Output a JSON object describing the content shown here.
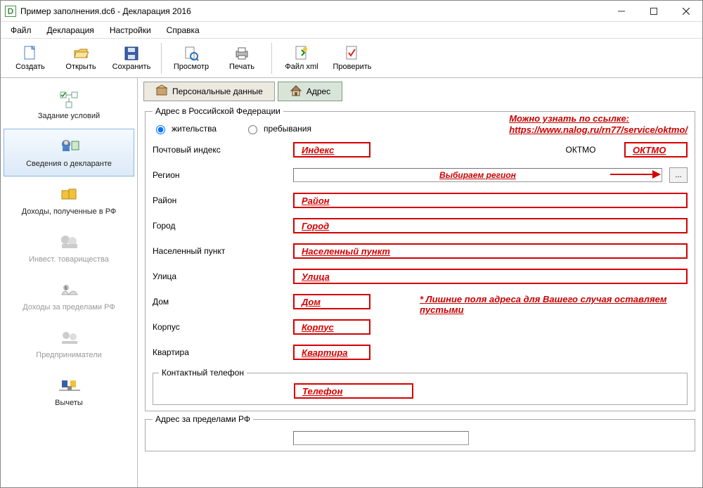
{
  "titlebar": {
    "app_letter": "D",
    "title": "Пример заполнения.dc6 - Декларация 2016"
  },
  "menubar": {
    "items": [
      "Файл",
      "Декларация",
      "Настройки",
      "Справка"
    ]
  },
  "toolbar": {
    "items": [
      {
        "label": "Создать"
      },
      {
        "label": "Открыть"
      },
      {
        "label": "Сохранить"
      },
      {
        "sep": true
      },
      {
        "label": "Просмотр"
      },
      {
        "label": "Печать"
      },
      {
        "sep": true
      },
      {
        "label": "Файл xml"
      },
      {
        "label": "Проверить"
      }
    ]
  },
  "sidebar": {
    "items": [
      {
        "label": "Задание условий",
        "disabled": false
      },
      {
        "label": "Сведения о декларанте",
        "selected": true
      },
      {
        "label": "Доходы, полученные в РФ"
      },
      {
        "label": "Инвест. товарищества",
        "disabled": true
      },
      {
        "label": "Доходы за пределами РФ",
        "disabled": true
      },
      {
        "label": "Предприниматели",
        "disabled": true
      },
      {
        "label": "Вычеты"
      }
    ]
  },
  "tabs": {
    "personal": "Персональные данные",
    "address": "Адрес"
  },
  "form": {
    "group1_legend": "Адрес в Российской Федерации",
    "residence_label": "жительства",
    "stay_label": "пребывания",
    "postal_label": "Почтовый индекс",
    "postal_hint": "Индекс",
    "oktmo_label": "ОКТМО",
    "oktmo_hint": "ОКТМО",
    "region_label": "Регион",
    "region_hint": "Выбираем регион",
    "region_browse": "...",
    "district_label": "Район",
    "district_hint": "Район",
    "city_label": "Город",
    "city_hint": "Город",
    "locality_label": "Населенный пункт",
    "locality_hint": "Населенный пункт",
    "street_label": "Улица",
    "street_hint": "Улица",
    "house_label": "Дом",
    "house_hint": "Дом",
    "building_label": "Корпус",
    "building_hint": "Корпус",
    "flat_label": "Квартира",
    "flat_hint": "Квартира",
    "phone_legend": "Контактный телефон",
    "phone_hint": "Телефон",
    "group2_legend": "Адрес за пределами РФ"
  },
  "annotations": {
    "link_title": "Можно узнать по ссылке:",
    "link_url": "https://www.nalog.ru/rn77/service/oktmo/",
    "empty_note": "* Лишние поля адреса для Вашего случая оставляем пустыми"
  }
}
